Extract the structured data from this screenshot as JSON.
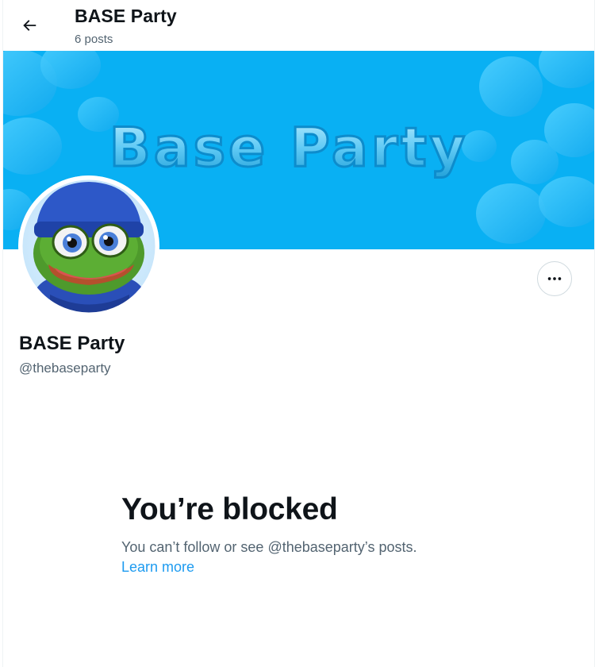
{
  "header": {
    "title": "BASE Party",
    "post_count": "6 posts",
    "back_icon": "arrow-left-icon"
  },
  "banner": {
    "text": "Base Party",
    "background_color": "#09b0f3",
    "shape_color": "#3cc6fb"
  },
  "profile": {
    "display_name": "BASE Party",
    "handle": "@thebaseparty",
    "avatar": "pepe-frog-avatar",
    "more_icon": "more-horizontal-icon"
  },
  "blocked": {
    "title": "You’re blocked",
    "message": "You can’t follow or see @thebaseparty’s posts.",
    "link_label": "Learn more",
    "link_color": "#1d9bf0"
  }
}
